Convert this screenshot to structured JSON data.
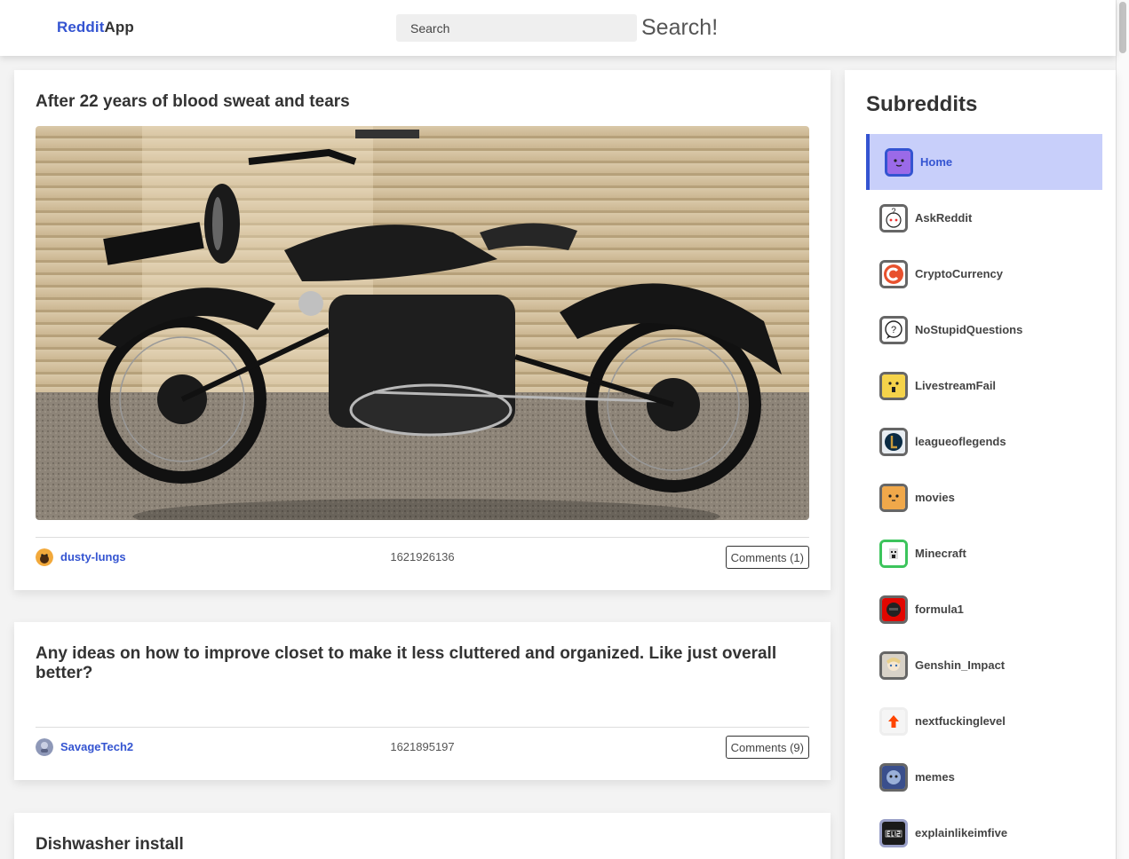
{
  "header": {
    "logo_accent": "Reddit",
    "logo_rest": "App",
    "search_placeholder": "Search",
    "search_button": "Search!"
  },
  "posts": [
    {
      "title": "After 22 years of blood sweat and tears",
      "author": "dusty-lungs",
      "timestamp": "1621926136",
      "comments_label": "Comments (1)",
      "has_image": true
    },
    {
      "title": "Any ideas on how to improve closet to make it less cluttered and organized. Like just overall better?",
      "author": "SavageTech2",
      "timestamp": "1621895197",
      "comments_label": "Comments (9)",
      "has_image": false
    },
    {
      "title": "Dishwasher install"
    }
  ],
  "sidebar": {
    "title": "Subreddits",
    "items": [
      {
        "label": "Home",
        "icon": "home-icon",
        "active": true,
        "color": "#9b6ae8"
      },
      {
        "label": "AskReddit",
        "icon": "askreddit-icon",
        "color": "#ffffff"
      },
      {
        "label": "CryptoCurrency",
        "icon": "cryptocurrency-icon",
        "color": "#e8512e"
      },
      {
        "label": "NoStupidQuestions",
        "icon": "nostupidquestions-icon",
        "color": "#ffffff"
      },
      {
        "label": "LivestreamFail",
        "icon": "livestreamfail-icon",
        "color": "#f5d34a"
      },
      {
        "label": "leagueoflegends",
        "icon": "leagueoflegends-icon",
        "color": "#0a2b44"
      },
      {
        "label": "movies",
        "icon": "movies-icon",
        "color": "#f0a84a"
      },
      {
        "label": "Minecraft",
        "icon": "minecraft-icon",
        "color": "#ffffff"
      },
      {
        "label": "formula1",
        "icon": "formula1-icon",
        "color": "#e10600"
      },
      {
        "label": "Genshin_Impact",
        "icon": "genshin-impact-icon",
        "color": "#d8d2c8"
      },
      {
        "label": "nextfuckinglevel",
        "icon": "nextfuckinglevel-icon",
        "color": "#ff4500"
      },
      {
        "label": "memes",
        "icon": "memes-icon",
        "color": "#3a4f8c"
      },
      {
        "label": "explainlikeimfive",
        "icon": "explainlikeimfive-icon",
        "color": "#1a1a1a"
      }
    ]
  },
  "colors": {
    "accent": "#3454d1",
    "active_bg": "#c8cffa",
    "page_bg": "#f3f3f3"
  }
}
